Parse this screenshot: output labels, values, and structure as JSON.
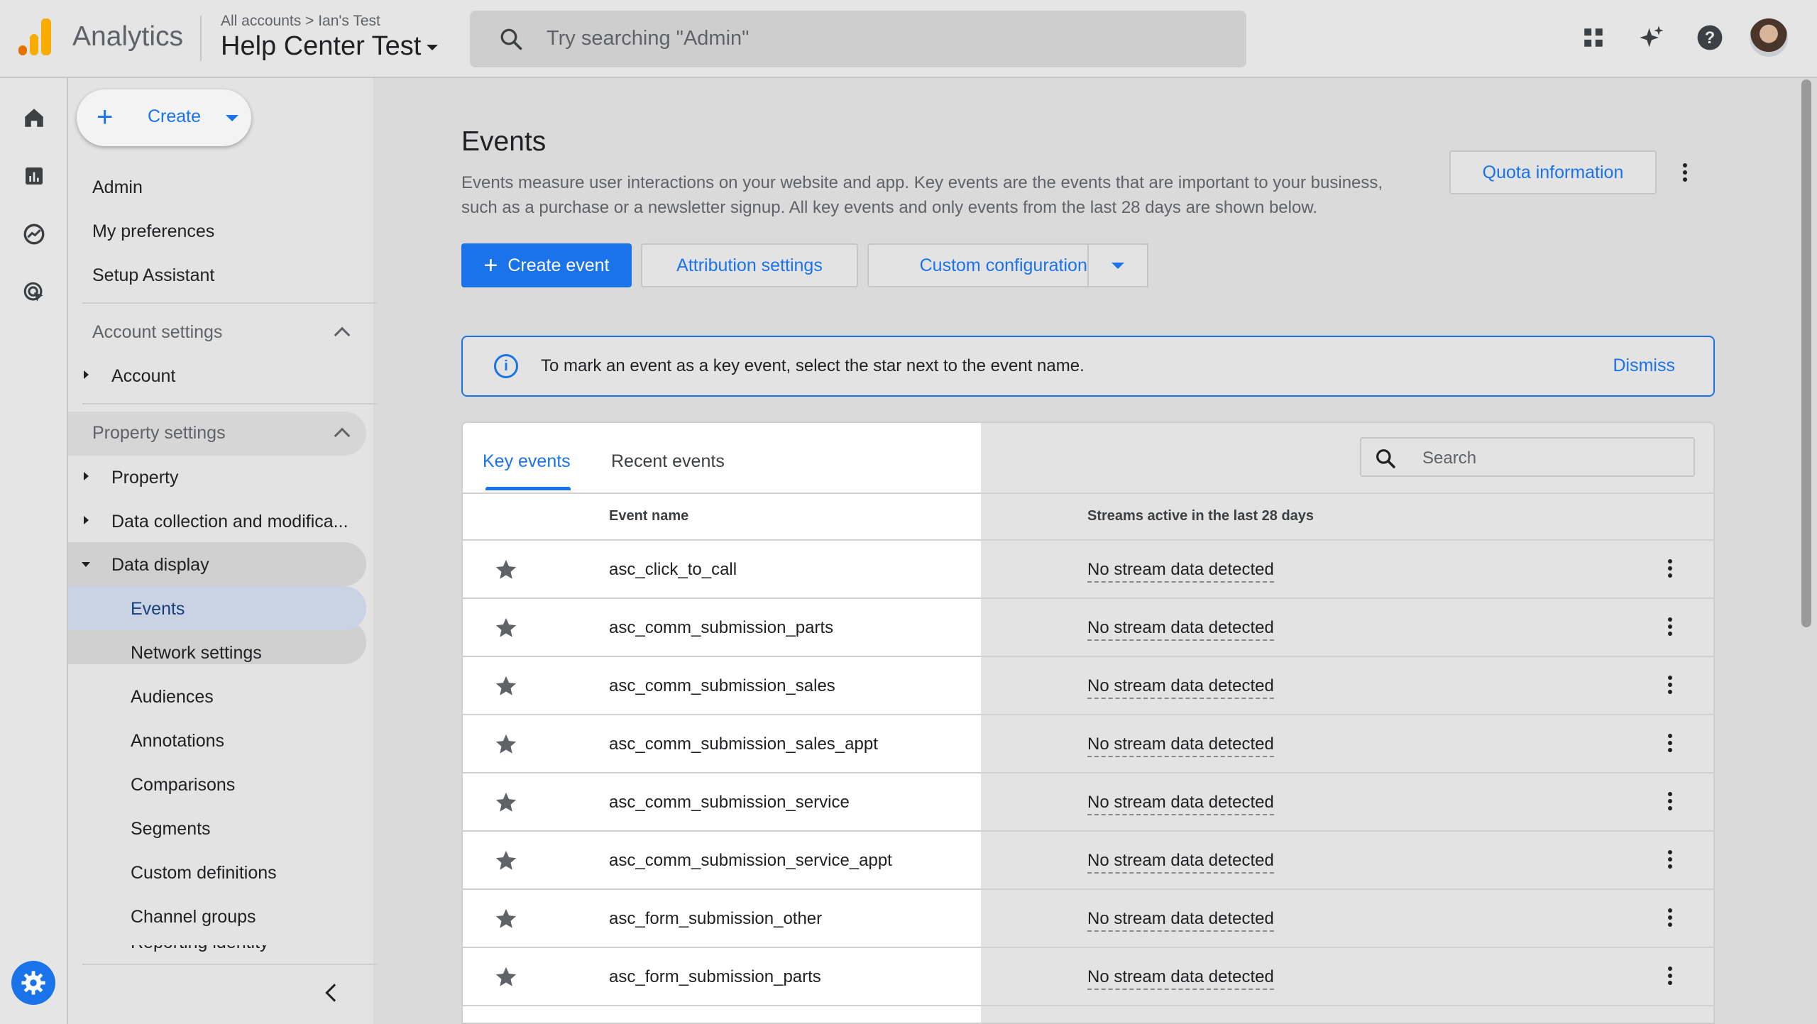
{
  "app": {
    "name": "Analytics"
  },
  "header": {
    "breadcrumb_root": "All accounts",
    "breadcrumb_sep": ">",
    "breadcrumb_account": "Ian's Test",
    "property_name": "Help Center Test",
    "search_placeholder": "Try searching \"Admin\""
  },
  "nav": {
    "create_label": "Create",
    "items_top": [
      "Admin",
      "My preferences",
      "Setup Assistant"
    ],
    "account_settings": "Account settings",
    "account": "Account",
    "property_settings": "Property settings",
    "property": "Property",
    "data_collection": "Data collection and modifica...",
    "data_display": "Data display",
    "sub_items": [
      "Events",
      "Network settings",
      "Audiences",
      "Annotations",
      "Comparisons",
      "Segments",
      "Custom definitions",
      "Channel groups"
    ],
    "truncated_item": "Reporting identity"
  },
  "page": {
    "title": "Events",
    "description": "Events measure user interactions on your website and app. Key events are the events that are important to your business, such as a purchase or a newsletter signup. All key events and only events from the last 28 days are shown below.",
    "quota_button": "Quota information",
    "create_event": "Create event",
    "attribution_settings": "Attribution settings",
    "custom_configurations": "Custom configurations"
  },
  "banner": {
    "text": "To mark an event as a key event, select the star next to the event name.",
    "dismiss": "Dismiss"
  },
  "table": {
    "tabs": [
      "Key events",
      "Recent events"
    ],
    "active_tab": "Key events",
    "search_placeholder": "Search",
    "col_event_name": "Event name",
    "col_streams": "Streams active in the last 28 days",
    "rows": [
      {
        "name": "asc_click_to_call",
        "streams": "No stream data detected"
      },
      {
        "name": "asc_comm_submission_parts",
        "streams": "No stream data detected"
      },
      {
        "name": "asc_comm_submission_sales",
        "streams": "No stream data detected"
      },
      {
        "name": "asc_comm_submission_sales_appt",
        "streams": "No stream data detected"
      },
      {
        "name": "asc_comm_submission_service",
        "streams": "No stream data detected"
      },
      {
        "name": "asc_comm_submission_service_appt",
        "streams": "No stream data detected"
      },
      {
        "name": "asc_form_submission_other",
        "streams": "No stream data detected"
      },
      {
        "name": "asc_form_submission_parts",
        "streams": "No stream data detected"
      }
    ]
  },
  "colors": {
    "accent": "#1a73e8",
    "logo_orange": "#f9ab00",
    "logo_dark": "#e37400"
  }
}
